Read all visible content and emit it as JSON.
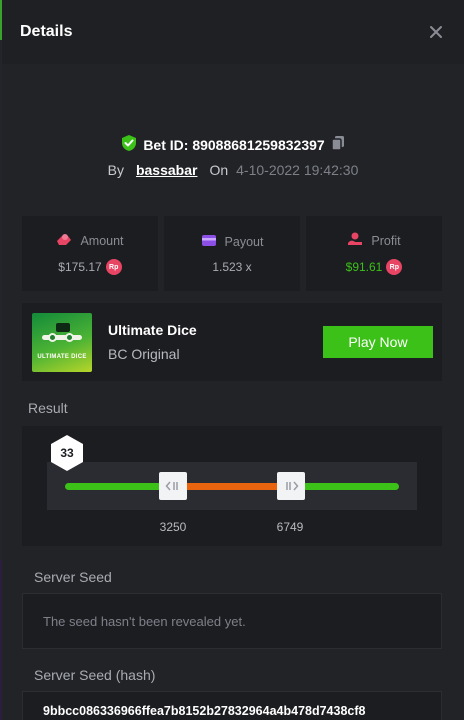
{
  "header": {
    "title": "Details"
  },
  "bet": {
    "id_label": "Bet ID: 89088681259832397",
    "by_label": "By",
    "username": "bassabar",
    "on_label": "On",
    "date": "4-10-2022 19:42:30"
  },
  "stats": {
    "amount": {
      "label": "Amount",
      "value": "$175.17"
    },
    "payout": {
      "label": "Payout",
      "value": "1.523 x"
    },
    "profit": {
      "label": "Profit",
      "value": "$91.61"
    },
    "currency_badge": "Rp"
  },
  "game": {
    "thumb_label": "ULTIMATE DICE",
    "name": "Ultimate Dice",
    "subtitle": "BC Original",
    "play_label": "Play Now"
  },
  "result": {
    "label": "Result",
    "roll": "33",
    "range_low": "3250",
    "range_high": "6749"
  },
  "server_seed": {
    "label": "Server Seed",
    "value": "The seed hasn't been revealed yet."
  },
  "server_seed_hash": {
    "label": "Server Seed (hash)",
    "value": "9bbcc086336966ffea7b8152b27832964a4b478d7438cf8"
  },
  "colors": {
    "accent_green": "#3bc117",
    "range_orange": "#e8640e",
    "currency_pink": "#e84565",
    "panel": "#1c1d21"
  }
}
